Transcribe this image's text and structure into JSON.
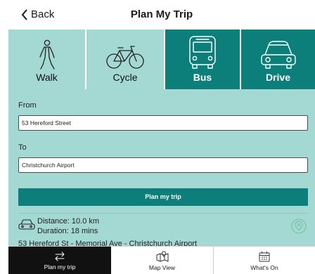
{
  "header": {
    "back_label": "Back",
    "title": "Plan My Trip"
  },
  "modes": [
    {
      "label": "Walk",
      "icon": "walk-icon",
      "selected": false
    },
    {
      "label": "Cycle",
      "icon": "bicycle-icon",
      "selected": false
    },
    {
      "label": "Bus",
      "icon": "bus-icon",
      "selected": true
    },
    {
      "label": "Drive",
      "icon": "car-icon",
      "selected": false
    }
  ],
  "form": {
    "from_label": "From",
    "from_value": "53 Hereford Street",
    "to_label": "To",
    "to_value": "Christchurch Airport",
    "plan_button": "Plan my trip"
  },
  "result": {
    "distance": "Distance: 10.0 km",
    "duration": "Duration: 18 mins",
    "route": "53 Hereford St - Memorial Ave - Christchurch Airport"
  },
  "tabs": [
    {
      "label": "Plan my trip",
      "icon": "swap-arrows-icon",
      "active": true
    },
    {
      "label": "Map View",
      "icon": "map-icon",
      "active": false
    },
    {
      "label": "What's On",
      "icon": "calendar-icon",
      "active": false
    }
  ],
  "colors": {
    "accent_dark": "#0d7f7a",
    "accent_light": "#a3d8d3",
    "active_tab": "#111111"
  }
}
